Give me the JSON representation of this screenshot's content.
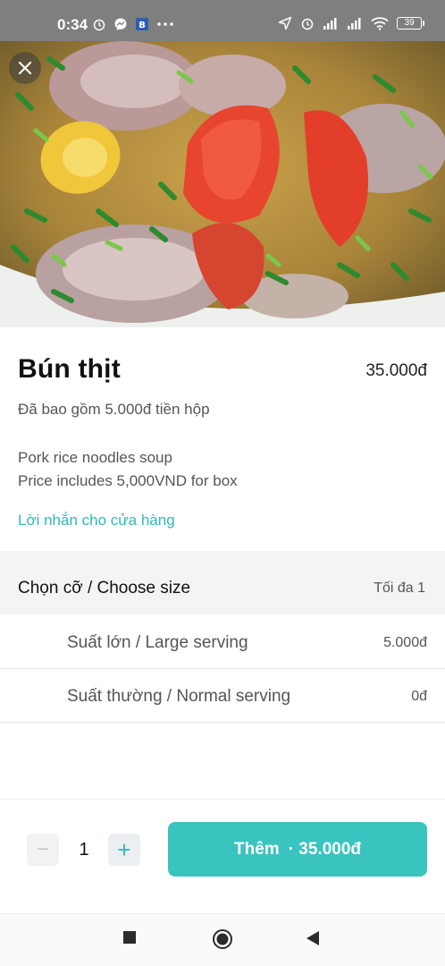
{
  "status_bar": {
    "time": "0:34",
    "battery": "39",
    "icons": [
      "alarm-icon",
      "messenger-icon",
      "app-icon",
      "more-icon",
      "location-icon",
      "alarm-icon",
      "signal-icon",
      "signal-icon",
      "wifi-icon",
      "battery-icon"
    ]
  },
  "hero": {
    "image": "pork-rice-noodle-soup-photo",
    "close_icon": "close-icon"
  },
  "product": {
    "name": "Bún thịt",
    "price": "35.000đ",
    "box_note": "Đã bao gồm 5.000đ tiền hộp",
    "description_line1": "Pork rice noodles soup",
    "description_line2": "Price includes 5,000VND for box",
    "message_link": "Lời nhắn cho cửa hàng"
  },
  "size_section": {
    "title": "Chọn cỡ / Choose size",
    "max": "Tối đa 1",
    "options": [
      {
        "label": "Suất lớn / Large serving",
        "price": "5.000đ"
      },
      {
        "label": "Suất thường / Normal serving",
        "price": "0đ"
      }
    ]
  },
  "footer": {
    "minus": "−",
    "quantity": "1",
    "plus": "+",
    "add_label": "Thêm",
    "add_separator": "·",
    "add_price": "35.000đ"
  },
  "navbar": {
    "icons": [
      "recents-icon",
      "home-icon",
      "back-icon"
    ]
  },
  "colors": {
    "accent": "#39c4c0",
    "link": "#2fb9b6",
    "status_bar": "#7f7f7f",
    "section_bg": "#f3f4f6"
  }
}
